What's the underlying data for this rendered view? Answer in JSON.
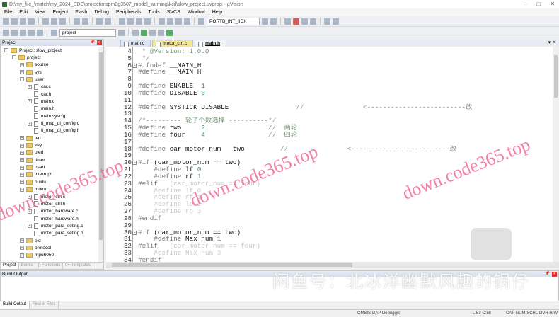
{
  "window": {
    "title": "D:\\my_file_\\match\\my_2024_EDC\\project\\mspm0g3507_model_wuming\\keil\\slow_project.uvprojx - µVision"
  },
  "menu": [
    "File",
    "Edit",
    "View",
    "Project",
    "Flash",
    "Debug",
    "Peripherals",
    "Tools",
    "SVCS",
    "Window",
    "Help"
  ],
  "toolbar": {
    "find_combo": "PORTB_INT_IIDX",
    "target_combo": "project"
  },
  "project_panel": {
    "title": "Project",
    "tree": [
      {
        "label": "Project: slow_project",
        "depth": 0,
        "type": "root",
        "exp": "-"
      },
      {
        "label": "project",
        "depth": 1,
        "type": "folder",
        "exp": "-"
      },
      {
        "label": "source",
        "depth": 2,
        "type": "folder",
        "exp": "+"
      },
      {
        "label": "sys",
        "depth": 2,
        "type": "folder",
        "exp": "+"
      },
      {
        "label": "user",
        "depth": 2,
        "type": "folder",
        "exp": "-"
      },
      {
        "label": "car.c",
        "depth": 3,
        "type": "file",
        "exp": "+"
      },
      {
        "label": "car.h",
        "depth": 3,
        "type": "file",
        "exp": ""
      },
      {
        "label": "main.c",
        "depth": 3,
        "type": "file",
        "exp": "+"
      },
      {
        "label": "main.h",
        "depth": 3,
        "type": "file",
        "exp": ""
      },
      {
        "label": "main.syscfg",
        "depth": 3,
        "type": "file",
        "exp": ""
      },
      {
        "label": "ti_msp_dl_config.c",
        "depth": 3,
        "type": "file",
        "exp": "+"
      },
      {
        "label": "ti_msp_dl_config.h",
        "depth": 3,
        "type": "file",
        "exp": ""
      },
      {
        "label": "led",
        "depth": 2,
        "type": "folder",
        "exp": "+"
      },
      {
        "label": "key",
        "depth": 2,
        "type": "folder",
        "exp": "+"
      },
      {
        "label": "oled",
        "depth": 2,
        "type": "folder",
        "exp": "+"
      },
      {
        "label": "timer",
        "depth": 2,
        "type": "folder",
        "exp": "+"
      },
      {
        "label": "usart",
        "depth": 2,
        "type": "folder",
        "exp": "+"
      },
      {
        "label": "interrupt",
        "depth": 2,
        "type": "folder",
        "exp": "+"
      },
      {
        "label": "huidu",
        "depth": 2,
        "type": "folder",
        "exp": "+"
      },
      {
        "label": "motor",
        "depth": 2,
        "type": "folder",
        "exp": "-"
      },
      {
        "label": "motor_ctrl.c",
        "depth": 3,
        "type": "file",
        "exp": "+"
      },
      {
        "label": "motor_ctrl.h",
        "depth": 3,
        "type": "file",
        "exp": ""
      },
      {
        "label": "motor_hardware.c",
        "depth": 3,
        "type": "file",
        "exp": "+"
      },
      {
        "label": "motor_hardware.h",
        "depth": 3,
        "type": "file",
        "exp": ""
      },
      {
        "label": "motor_para_seting.c",
        "depth": 3,
        "type": "file",
        "exp": "+"
      },
      {
        "label": "motor_para_seting.h",
        "depth": 3,
        "type": "file",
        "exp": ""
      },
      {
        "label": "pid",
        "depth": 2,
        "type": "folder",
        "exp": "+"
      },
      {
        "label": "protocol",
        "depth": 2,
        "type": "folder",
        "exp": "+"
      },
      {
        "label": "mpu6050",
        "depth": 2,
        "type": "folder",
        "exp": "+"
      }
    ],
    "tabs": [
      "Project",
      "Books",
      "{} Functions",
      "0+ Templates"
    ]
  },
  "editor": {
    "tabs": [
      {
        "label": "main.c",
        "style": "n"
      },
      {
        "label": "motor_ctrl.c",
        "style": "y"
      },
      {
        "label": "main.h",
        "style": "act"
      }
    ],
    "lines": [
      {
        "n": "4",
        "fold": "",
        "seg": [
          [
            " * @Version: 1.0.0",
            "cm"
          ]
        ]
      },
      {
        "n": "5",
        "fold": "",
        "seg": [
          [
            " */",
            "cm"
          ]
        ]
      },
      {
        "n": "6",
        "fold": "-",
        "seg": [
          [
            "#ifndef ",
            "pp"
          ],
          [
            "__MAIN_H",
            "id"
          ]
        ]
      },
      {
        "n": "7",
        "fold": "",
        "seg": [
          [
            "#define ",
            "pp"
          ],
          [
            "__MAIN_H",
            "id"
          ]
        ]
      },
      {
        "n": "8",
        "fold": "",
        "seg": []
      },
      {
        "n": "9",
        "fold": "",
        "seg": [
          [
            "#define ",
            "pp"
          ],
          [
            "ENABLE  ",
            "id"
          ],
          [
            "1",
            "num"
          ]
        ]
      },
      {
        "n": "10",
        "fold": "",
        "seg": [
          [
            "#define ",
            "pp"
          ],
          [
            "DISABLE ",
            "id"
          ],
          [
            "0",
            "num"
          ]
        ]
      },
      {
        "n": "11",
        "fold": "",
        "seg": []
      },
      {
        "n": "12",
        "fold": "",
        "seg": [
          [
            "#define ",
            "pp"
          ],
          [
            "SYSTICK DISABLE",
            "id"
          ],
          [
            "                 //",
            "cm"
          ],
          [
            "               <-------------------------改",
            "dash"
          ]
        ]
      },
      {
        "n": "13",
        "fold": "",
        "seg": []
      },
      {
        "n": "14",
        "fold": "",
        "seg": [
          [
            "/*--------- 轮子个数选择 ----------*/",
            "cm"
          ]
        ]
      },
      {
        "n": "15",
        "fold": "",
        "seg": [
          [
            "#define ",
            "pp"
          ],
          [
            "two     ",
            "id"
          ],
          [
            "2",
            "num"
          ],
          [
            "                //  两轮",
            "cm"
          ]
        ]
      },
      {
        "n": "16",
        "fold": "",
        "seg": [
          [
            "#define ",
            "pp"
          ],
          [
            "four    ",
            "id"
          ],
          [
            "4",
            "num"
          ],
          [
            "                //  四轮",
            "cm"
          ]
        ]
      },
      {
        "n": "17",
        "fold": "",
        "seg": []
      },
      {
        "n": "18",
        "fold": "",
        "seg": [
          [
            "#define ",
            "pp"
          ],
          [
            "car_motor_num   two",
            "id"
          ],
          [
            "         //",
            "cm"
          ],
          [
            "               <-------------------------改",
            "dash"
          ]
        ]
      },
      {
        "n": "19",
        "fold": "",
        "seg": []
      },
      {
        "n": "20",
        "fold": "-",
        "seg": [
          [
            "#if ",
            "pp"
          ],
          [
            "(car_motor_num == two)",
            "id"
          ]
        ]
      },
      {
        "n": "21",
        "fold": "",
        "seg": [
          [
            "    #define ",
            "pp"
          ],
          [
            "lf ",
            "id"
          ],
          [
            "0",
            "num"
          ]
        ]
      },
      {
        "n": "22",
        "fold": "",
        "seg": [
          [
            "    #define ",
            "pp"
          ],
          [
            "rf ",
            "id"
          ],
          [
            "1",
            "num"
          ]
        ]
      },
      {
        "n": "23",
        "fold": "",
        "seg": [
          [
            "#elif   ",
            "pp"
          ],
          [
            "(car_motor_num == four)",
            "in"
          ]
        ]
      },
      {
        "n": "24",
        "fold": "",
        "seg": [
          [
            "    #define lf 0",
            "in"
          ]
        ]
      },
      {
        "n": "25",
        "fold": "",
        "seg": [
          [
            "    #define rf 1",
            "in"
          ]
        ]
      },
      {
        "n": "26",
        "fold": "",
        "seg": [
          [
            "    #define lb 2",
            "in"
          ]
        ]
      },
      {
        "n": "27",
        "fold": "",
        "seg": [
          [
            "    #define rb 3",
            "in"
          ]
        ]
      },
      {
        "n": "28",
        "fold": "",
        "seg": [
          [
            "#endif",
            "pp"
          ]
        ]
      },
      {
        "n": "29",
        "fold": "",
        "seg": []
      },
      {
        "n": "30",
        "fold": "-",
        "seg": [
          [
            "#if ",
            "pp"
          ],
          [
            "(car_motor_num == two)",
            "id"
          ]
        ]
      },
      {
        "n": "31",
        "fold": "",
        "seg": [
          [
            "    #define ",
            "pp"
          ],
          [
            "Max_num ",
            "id"
          ],
          [
            "1",
            "num"
          ]
        ]
      },
      {
        "n": "32",
        "fold": "",
        "seg": [
          [
            "#elif   ",
            "pp"
          ],
          [
            "(car_motor_num == four)",
            "in"
          ]
        ]
      },
      {
        "n": "33",
        "fold": "",
        "seg": [
          [
            "    #define Max_num 3",
            "in"
          ]
        ]
      },
      {
        "n": "34",
        "fold": "",
        "seg": [
          [
            "#endif",
            "pp"
          ]
        ]
      }
    ]
  },
  "build_output": {
    "title": "Build Output",
    "tabs": [
      "Build Output",
      "Find in Files"
    ]
  },
  "status": {
    "debugger": "CMSIS-DAP Debugger",
    "position": "L:53 C:88",
    "flags": "CAP  NUM  SCRL  OVR  R/W"
  },
  "watermarks": {
    "site": "down.code365.top",
    "seller": "闲鱼号：北冰洋幽默风趣的锅仔"
  }
}
